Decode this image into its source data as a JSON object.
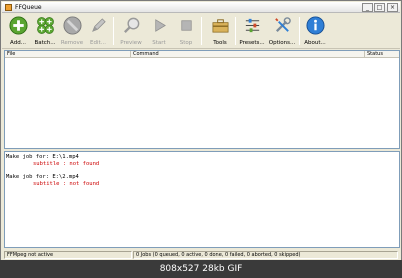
{
  "window": {
    "title": "FFQueue"
  },
  "window_controls": {
    "minimize": "_",
    "maximize": "□",
    "close": "×"
  },
  "toolbar": {
    "add": "Add...",
    "batch": "Batch...",
    "remove": "Remove",
    "edit": "Edit...",
    "preview": "Preview",
    "start": "Start",
    "stop": "Stop",
    "tools": "Tools",
    "presets": "Presets...",
    "options": "Options...",
    "about": "About..."
  },
  "jobs": {
    "columns": [
      "File",
      "Command",
      "Status"
    ]
  },
  "log": {
    "lines": [
      {
        "text": "Make job for: E:\\1.mp4",
        "type": "info"
      },
      {
        "text": "subtitle : not found",
        "type": "error"
      },
      {
        "text": "Make job for: E:\\2.mp4",
        "type": "info"
      },
      {
        "text": "subtitle : not found",
        "type": "error"
      }
    ]
  },
  "status": {
    "ffmpeg": "FFMpeg not active",
    "jobs": "0 Jobs (0 queued, 0 active, 0 done, 0 failed, 0 aborted, 0 skipped)"
  },
  "caption": {
    "text": "808x527  28kb  GIF"
  },
  "colors": {
    "error": "#cc0000",
    "accent_green": "#5aa531",
    "accent_blue": "#2f7fd6"
  }
}
